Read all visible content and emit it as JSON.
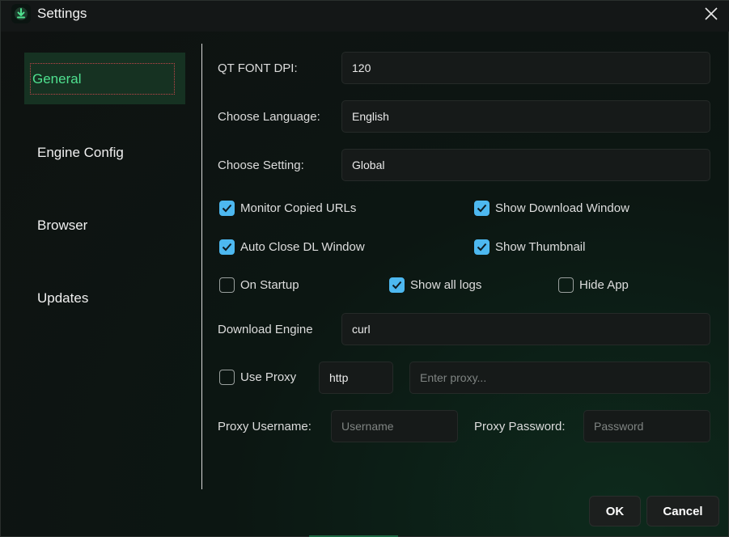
{
  "window": {
    "title": "Settings"
  },
  "sidebar": {
    "items": [
      {
        "label": "General",
        "active": true
      },
      {
        "label": "Engine Config",
        "active": false
      },
      {
        "label": "Browser",
        "active": false
      },
      {
        "label": "Updates",
        "active": false
      }
    ]
  },
  "general": {
    "font_dpi": {
      "label": "QT FONT DPI:",
      "value": "120"
    },
    "language": {
      "label": "Choose Language:",
      "value": "English"
    },
    "setting": {
      "label": "Choose Setting:",
      "value": "Global"
    },
    "checkboxes": {
      "monitor_urls": {
        "label": "Monitor Copied URLs",
        "checked": true
      },
      "show_download_window": {
        "label": "Show Download Window",
        "checked": true
      },
      "auto_close": {
        "label": "Auto Close DL Window",
        "checked": true
      },
      "show_thumbnail": {
        "label": "Show Thumbnail",
        "checked": true
      },
      "on_startup": {
        "label": "On Startup",
        "checked": false
      },
      "show_all_logs": {
        "label": "Show all logs",
        "checked": true
      },
      "hide_app": {
        "label": "Hide App",
        "checked": false
      }
    },
    "download_engine": {
      "label": "Download Engine",
      "value": "curl"
    },
    "proxy": {
      "use_label": "Use Proxy",
      "use_checked": false,
      "type_value": "http",
      "address_placeholder": "Enter proxy...",
      "username_label": "Proxy Username:",
      "username_placeholder": "Username",
      "password_label": "Proxy Password:",
      "password_placeholder": "Password"
    }
  },
  "buttons": {
    "ok": "OK",
    "cancel": "Cancel"
  },
  "colors": {
    "accent_green": "#4fe08f",
    "checkbox_blue": "#4db8f0",
    "active_bg": "#163222"
  }
}
